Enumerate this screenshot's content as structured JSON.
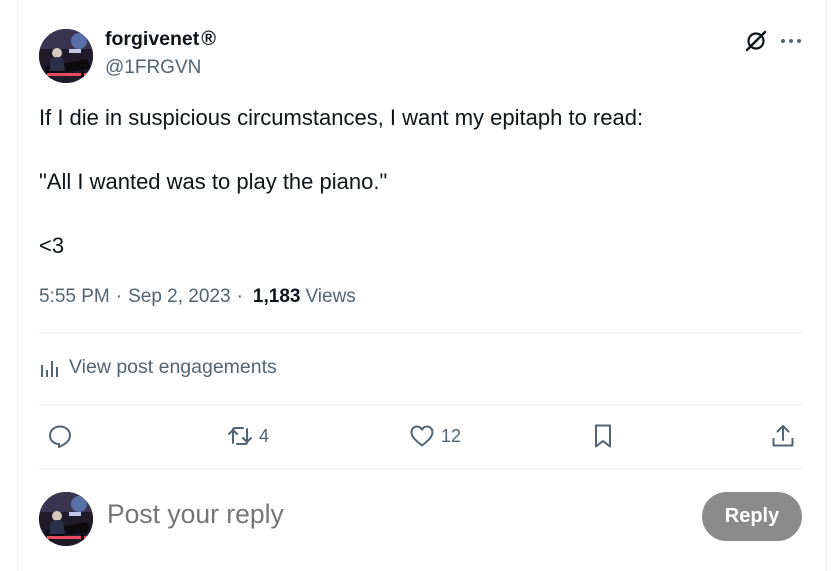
{
  "post": {
    "author": {
      "display_name": "forgivenet",
      "badge": "®",
      "handle": "@1FRGVN",
      "avatar_icon": "pianist-avatar"
    },
    "text_lines": [
      "If I die in suspicious circumstances, I want my epitaph to read:",
      "\"All I wanted was to play the piano.\"",
      "<3"
    ],
    "time": "5:55 PM",
    "date": "Sep 2, 2023",
    "separator": "·",
    "views_count": "1,183",
    "views_label": "Views"
  },
  "header_icons": {
    "grok": "grok-icon",
    "more": "more-icon"
  },
  "engagements_link": "View post engagements",
  "actions": {
    "reply_count": "",
    "retweet_count": "4",
    "like_count": "12"
  },
  "composer": {
    "placeholder": "Post your reply",
    "button_label": "Reply"
  },
  "colors": {
    "text": "#0f1419",
    "secondary": "#536471",
    "divider": "#eff3f4",
    "reply_button": "#8b8b8b"
  }
}
